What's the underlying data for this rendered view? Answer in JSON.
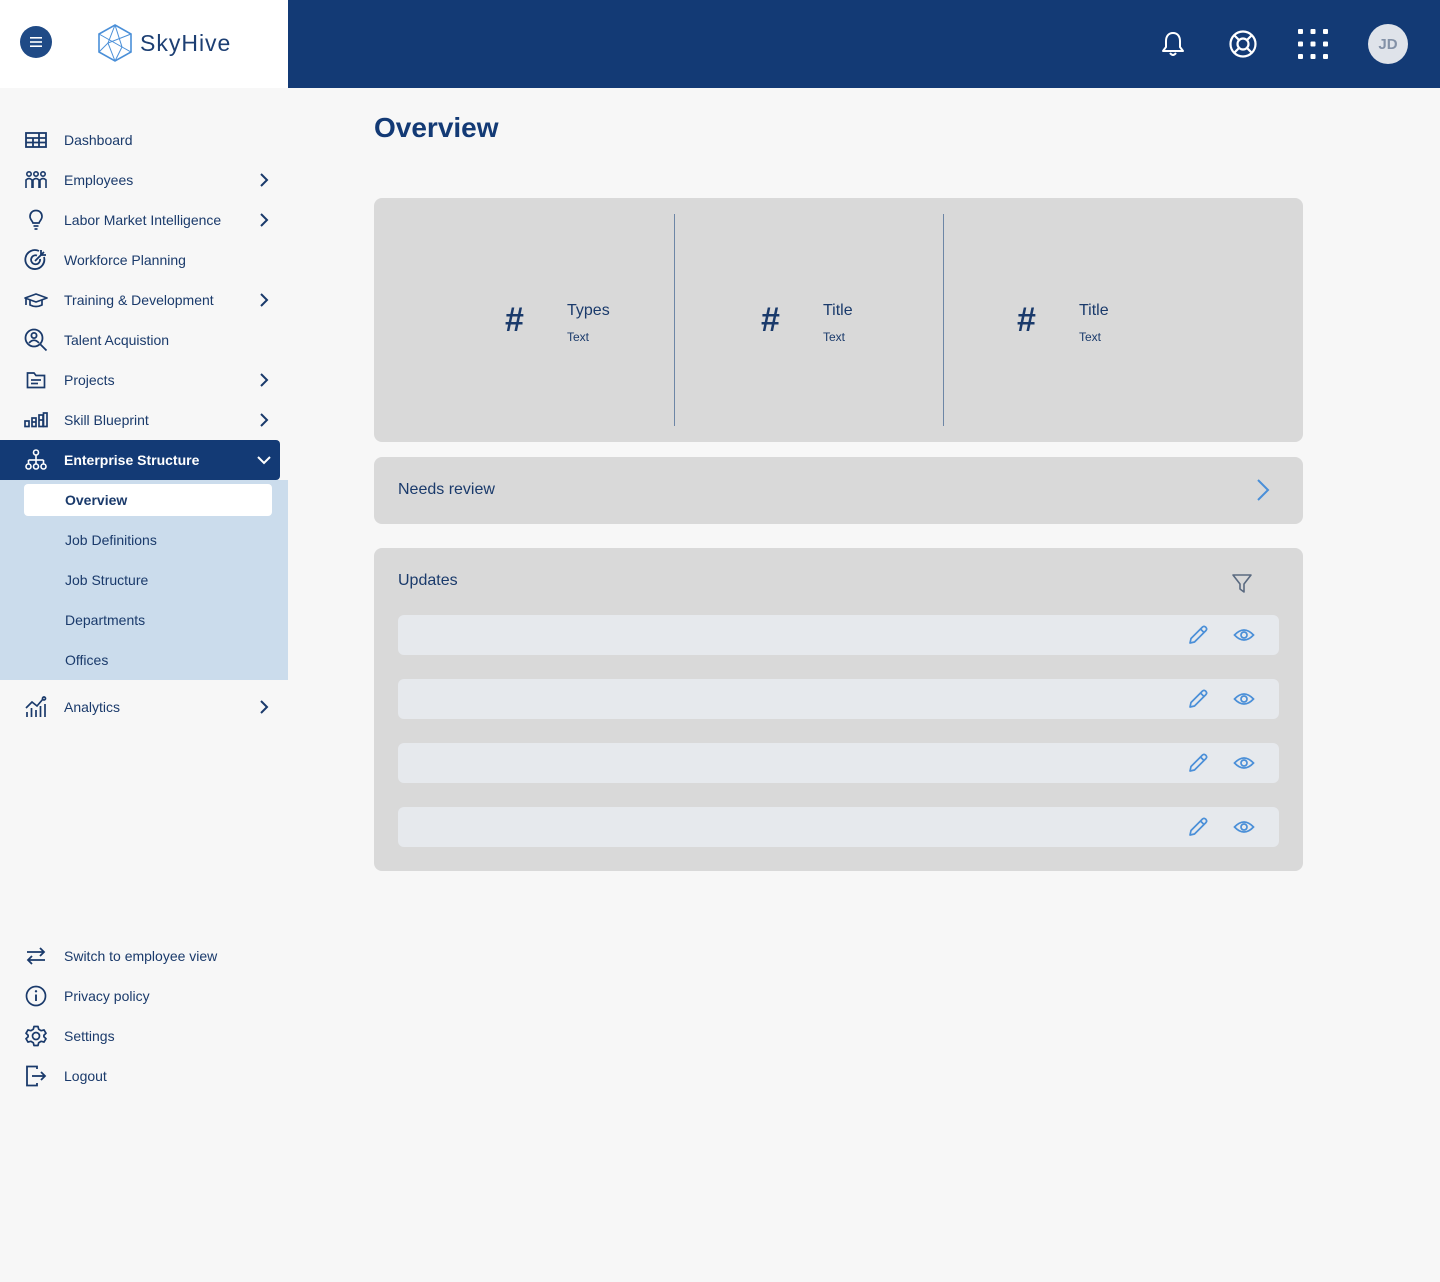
{
  "app": {
    "brand": "SkyHive",
    "user_initials": "JD"
  },
  "header": {
    "icons": [
      "menu-icon",
      "bell-icon",
      "lifebuoy-icon",
      "app-grid-icon"
    ]
  },
  "sidebar": {
    "items": [
      {
        "label": "Dashboard",
        "icon": "dashboard-icon",
        "has_children": false
      },
      {
        "label": "Employees",
        "icon": "people-icon",
        "has_children": true
      },
      {
        "label": "Labor Market Intelligence",
        "icon": "lightbulb-icon",
        "has_children": true
      },
      {
        "label": "Workforce Planning",
        "icon": "target-icon",
        "has_children": false
      },
      {
        "label": "Training & Development",
        "icon": "graduation-cap-icon",
        "has_children": true
      },
      {
        "label": "Talent Acquistion",
        "icon": "person-search-icon",
        "has_children": false
      },
      {
        "label": "Projects",
        "icon": "folder-icon",
        "has_children": true
      },
      {
        "label": "Skill Blueprint",
        "icon": "bars-icon",
        "has_children": true
      },
      {
        "label": "Enterprise Structure",
        "icon": "org-chart-icon",
        "has_children": true,
        "expanded": true
      }
    ],
    "enterprise_sub": [
      "Overview",
      "Job Definitions",
      "Job Structure",
      "Departments",
      "Offices"
    ],
    "enterprise_sub_selected": "Overview",
    "analytics": {
      "label": "Analytics",
      "icon": "analytics-icon"
    },
    "footer": [
      {
        "label": "Switch to employee view",
        "icon": "swap-icon"
      },
      {
        "label": "Privacy policy",
        "icon": "info-icon"
      },
      {
        "label": "Settings",
        "icon": "gear-icon"
      },
      {
        "label": "Logout",
        "icon": "logout-icon"
      }
    ]
  },
  "main": {
    "title": "Overview",
    "stats": [
      {
        "symbol": "#",
        "title": "Types",
        "sub": "Text"
      },
      {
        "symbol": "#",
        "title": "Title",
        "sub": "Text"
      },
      {
        "symbol": "#",
        "title": "Title",
        "sub": "Text"
      }
    ],
    "needs_review": "Needs review",
    "updates": {
      "title": "Updates",
      "row_actions": [
        "pencil-icon",
        "eye-icon"
      ],
      "row_count": 4
    }
  },
  "colors": {
    "topbar": "#133a75",
    "accent": "#4a8fd8",
    "sidebar_active": "#133a75",
    "subnav_bg": "#cbdcec",
    "card_bg": "#d9d9d9"
  }
}
